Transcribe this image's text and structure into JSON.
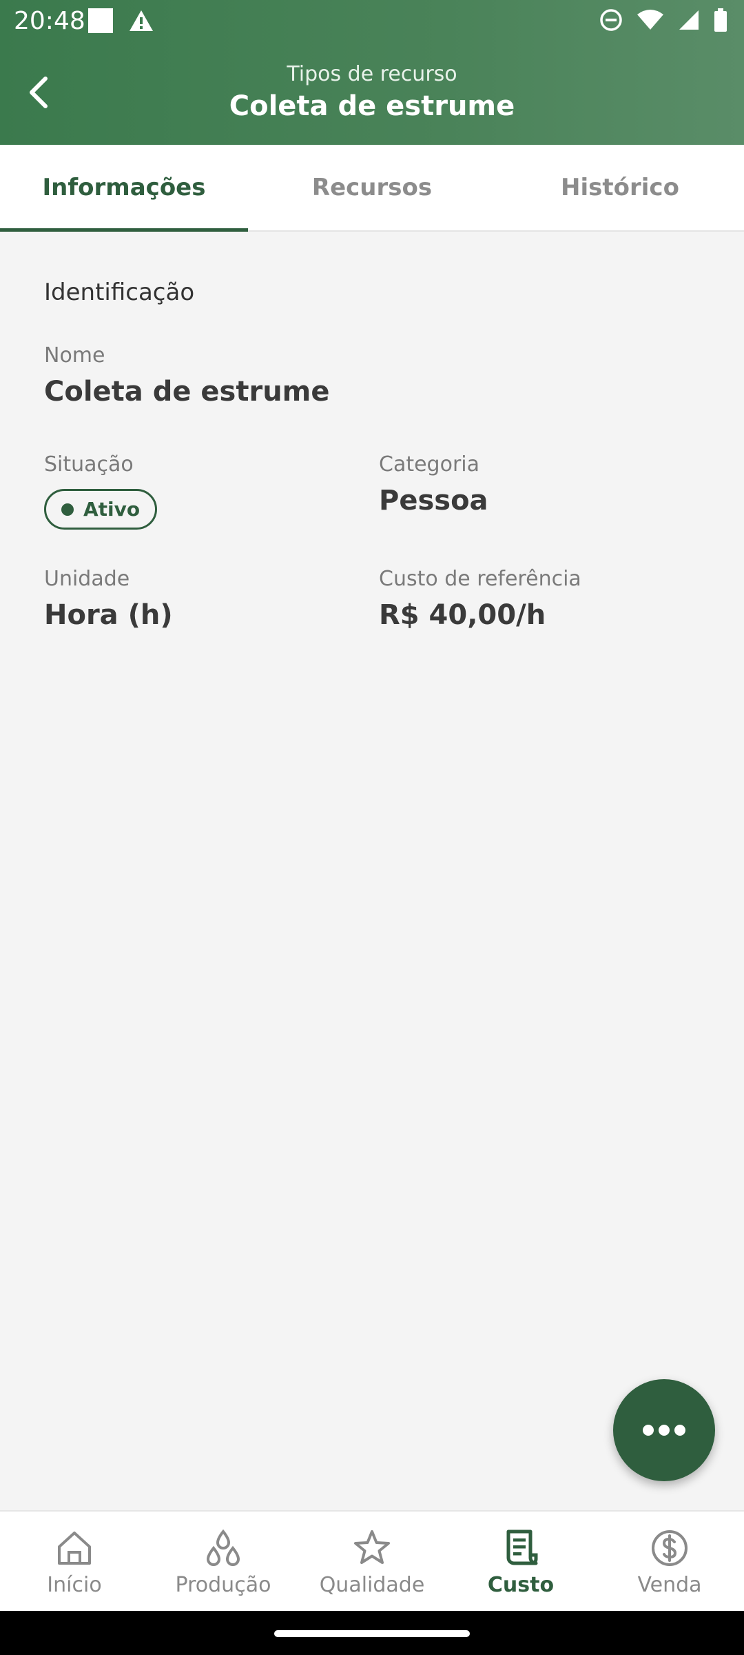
{
  "status_bar": {
    "time": "20:48"
  },
  "app_bar": {
    "subtitle": "Tipos de recurso",
    "title": "Coleta de estrume"
  },
  "tabs": [
    {
      "label": "Informações",
      "active": true
    },
    {
      "label": "Recursos",
      "active": false
    },
    {
      "label": "Histórico",
      "active": false
    }
  ],
  "section": {
    "title": "Identificação"
  },
  "fields": {
    "nome": {
      "label": "Nome",
      "value": "Coleta de estrume"
    },
    "situacao": {
      "label": "Situação",
      "value": "Ativo"
    },
    "categoria": {
      "label": "Categoria",
      "value": "Pessoa"
    },
    "unidade": {
      "label": "Unidade",
      "value": "Hora (h)"
    },
    "custo": {
      "label": "Custo de referência",
      "value": "R$ 40,00/h"
    }
  },
  "bottom_nav": [
    {
      "label": "Início",
      "icon": "home-icon"
    },
    {
      "label": "Produção",
      "icon": "droplets-icon"
    },
    {
      "label": "Qualidade",
      "icon": "star-icon"
    },
    {
      "label": "Custo",
      "icon": "receipt-icon",
      "active": true
    },
    {
      "label": "Venda",
      "icon": "dollar-circle-icon"
    }
  ],
  "colors": {
    "primary": "#2f5e3e",
    "header": "#3b7a4d",
    "background": "#f4f4f4"
  }
}
